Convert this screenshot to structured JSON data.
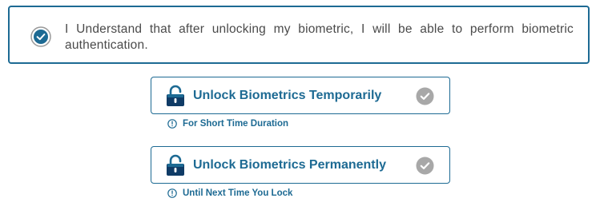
{
  "consent": {
    "checked": true,
    "text": "I Understand that after unlocking my biometric, I will be able to perform biometric authentication."
  },
  "options": [
    {
      "label": "Unlock Biometrics Temporarily",
      "icon": "unlocked-padlock-icon",
      "status_icon": "check-circle-icon",
      "hint": "For Short Time Duration",
      "hint_icon": "info-icon"
    },
    {
      "label": "Unlock Biometrics Permanently",
      "icon": "unlocked-padlock-icon",
      "status_icon": "check-circle-icon",
      "hint": "Until Next Time You Lock",
      "hint_icon": "info-icon"
    }
  ],
  "colors": {
    "accent": "#1d6a93",
    "check_gray": "#a8a8a8",
    "text": "#4a4a4a"
  }
}
